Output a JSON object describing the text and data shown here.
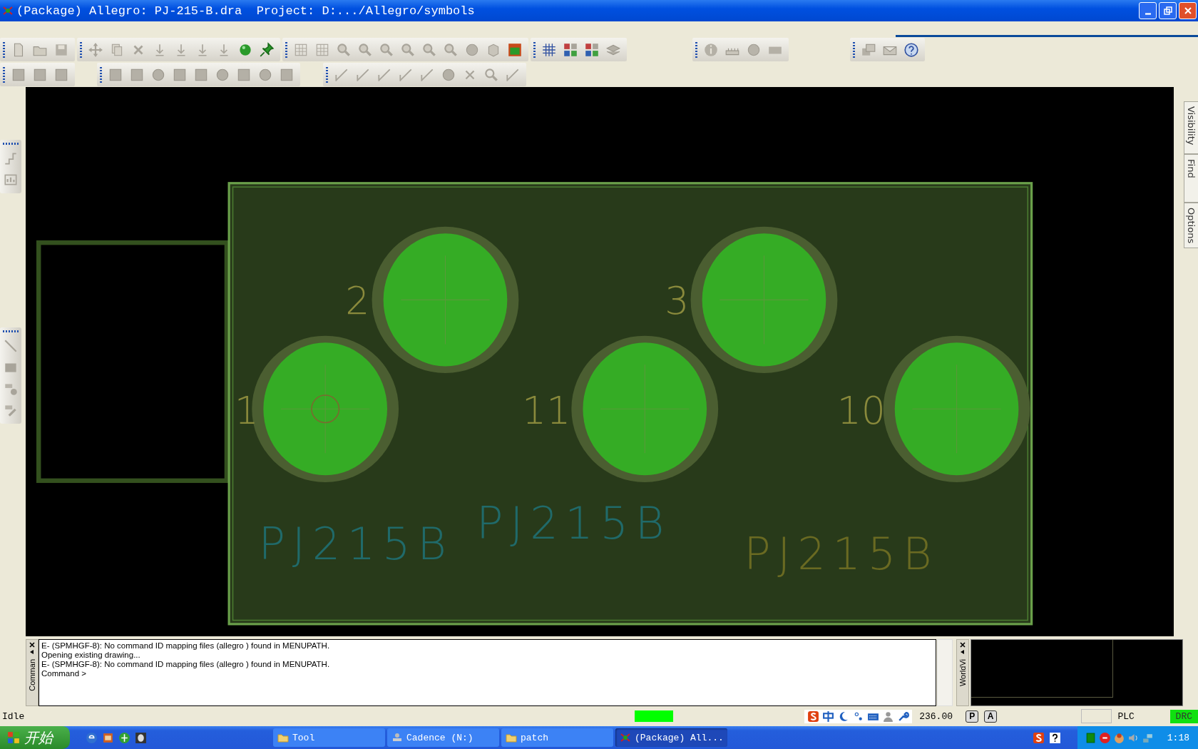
{
  "window": {
    "title": "(Package) Allegro: PJ-215-B.dra  Project: D:.../Allegro/symbols"
  },
  "side_tabs": [
    {
      "label": "Visibility"
    },
    {
      "label": "Find"
    },
    {
      "label": "Options"
    }
  ],
  "canvas": {
    "pins": [
      {
        "number": "1"
      },
      {
        "number": "2"
      },
      {
        "number": "11"
      },
      {
        "number": "3"
      },
      {
        "number": "10"
      }
    ],
    "ref_labels": [
      {
        "text": "PJ215B",
        "color": "#206a6a"
      },
      {
        "text": "PJ215B",
        "color": "#206a6a"
      },
      {
        "text": "PJ215B",
        "color": "#6a6a22"
      }
    ]
  },
  "command_window": {
    "title": "Comman",
    "lines": [
      "E- (SPMHGF-8): No command ID mapping files (allegro ) found in MENUPATH.",
      "Opening existing drawing...",
      "E- (SPMHGF-8): No command ID mapping files (allegro ) found in MENUPATH.",
      "Command >"
    ]
  },
  "world_view": {
    "title": "WorldVi"
  },
  "status_bar": {
    "state": "Idle",
    "coordinate": "236.00",
    "buttons": [
      "P",
      "A"
    ],
    "mode": "PLC",
    "drc": "DRC"
  },
  "taskbar": {
    "start": "开始",
    "tasks": [
      {
        "label": "Tool",
        "kind": "folder",
        "selected": false
      },
      {
        "label": "Cadence (N:)",
        "kind": "drive",
        "selected": false
      },
      {
        "label": "patch",
        "kind": "folder",
        "selected": false
      },
      {
        "label": "(Package) All...",
        "kind": "app",
        "selected": true
      }
    ],
    "clock": "1:18"
  }
}
